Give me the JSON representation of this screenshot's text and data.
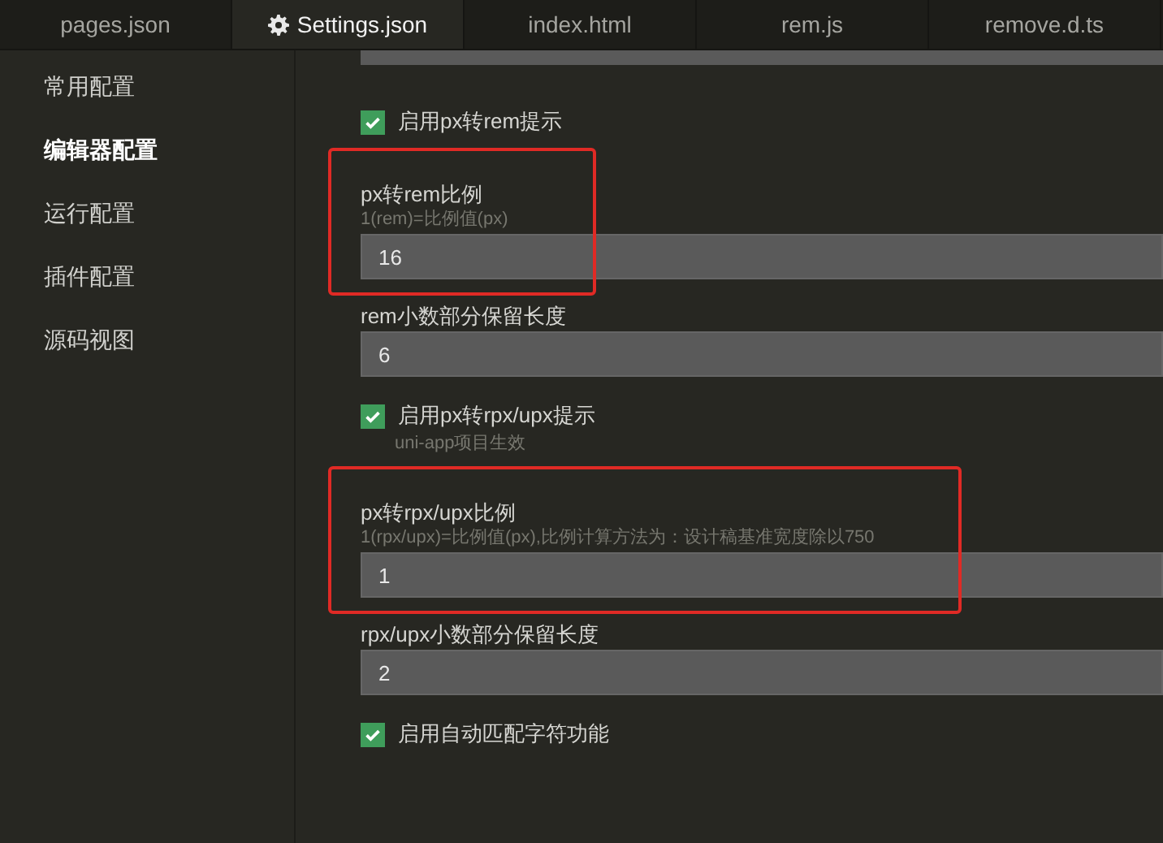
{
  "tabs": [
    {
      "label": "pages.json",
      "selected": false
    },
    {
      "label": "Settings.json",
      "selected": true
    },
    {
      "label": "index.html",
      "selected": false
    },
    {
      "label": "rem.js",
      "selected": false
    },
    {
      "label": "remove.d.ts",
      "selected": false
    }
  ],
  "sidebar": {
    "items": [
      {
        "label": "常用配置",
        "selected": false
      },
      {
        "label": "编辑器配置",
        "selected": true
      },
      {
        "label": "运行配置",
        "selected": false
      },
      {
        "label": "插件配置",
        "selected": false
      },
      {
        "label": "源码视图",
        "selected": false
      }
    ]
  },
  "settings": [
    {
      "kind": "checkbox",
      "label": "启用px转rem提示",
      "checked": true
    },
    {
      "kind": "number",
      "label": "px转rem比例",
      "hint": "1(rem)=比例值(px)",
      "value": "16",
      "highlighted": true
    },
    {
      "kind": "number",
      "label": "rem小数部分保留长度",
      "value": "6",
      "highlighted": false
    },
    {
      "kind": "checkbox",
      "label": "启用px转rpx/upx提示",
      "hint": "uni-app项目生效",
      "checked": true
    },
    {
      "kind": "number",
      "label": "px转rpx/upx比例",
      "hint": "1(rpx/upx)=比例值(px),比例计算方法为：设计稿基准宽度除以750",
      "value": "1",
      "highlighted": true
    },
    {
      "kind": "number",
      "label": "rpx/upx小数部分保留长度",
      "value": "2",
      "highlighted": false
    },
    {
      "kind": "checkbox",
      "label": "启用自动匹配字符功能",
      "checked": true
    }
  ]
}
